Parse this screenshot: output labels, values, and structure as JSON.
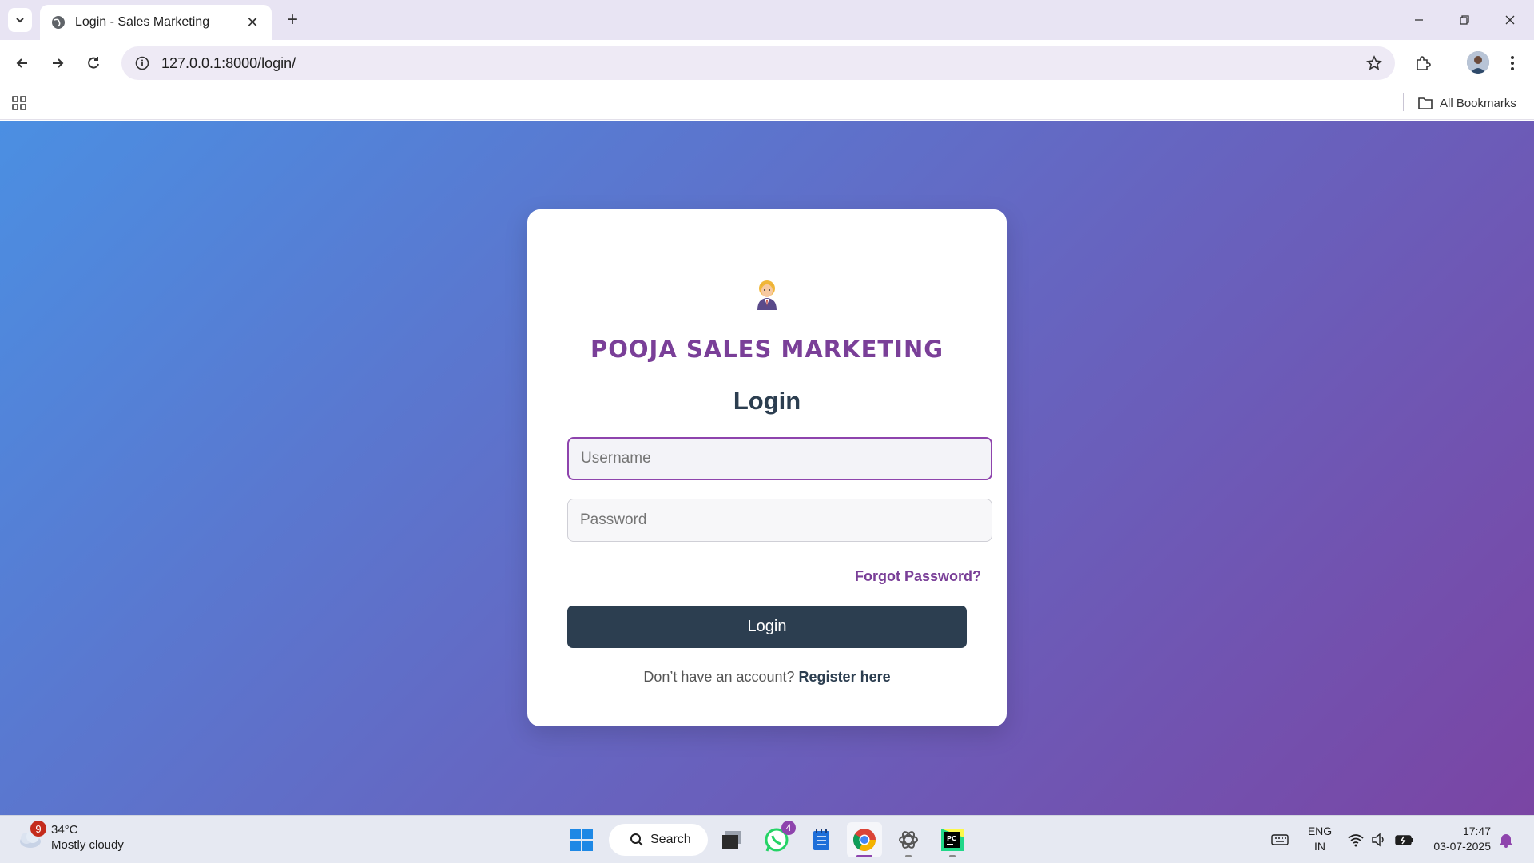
{
  "browser": {
    "tab_title": "Login - Sales Marketing",
    "url": "127.0.0.1:8000/login/",
    "all_bookmarks_label": "All Bookmarks"
  },
  "login_card": {
    "brand": "POOJA SALES MARKETING",
    "heading": "Login",
    "username_placeholder": "Username",
    "password_placeholder": "Password",
    "forgot_password": "Forgot Password?",
    "login_button": "Login",
    "no_account_text": "Don’t have an account?",
    "register_link": "Register here"
  },
  "taskbar": {
    "weather": {
      "badge": "9",
      "temp": "34°C",
      "condition": "Mostly cloudy"
    },
    "search_label": "Search",
    "whatsapp_badge": "4",
    "lang_line1": "ENG",
    "lang_line2": "IN",
    "time": "17:47",
    "date": "03-07-2025"
  },
  "colors": {
    "brand": "#7a3f98",
    "button": "#2c3e50",
    "gradient_start": "#4b8fe2",
    "gradient_end": "#7a45a4"
  }
}
